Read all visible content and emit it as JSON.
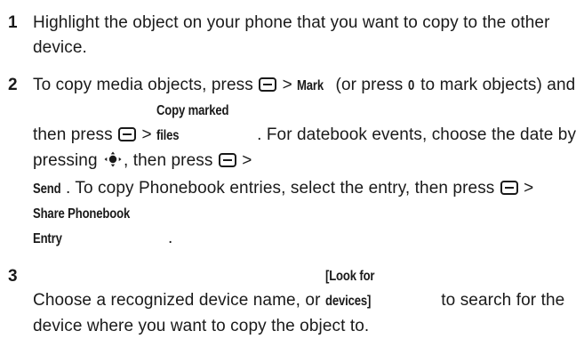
{
  "steps": [
    {
      "number": "1",
      "segments": {
        "s1": "Highlight the object on your phone that you want to copy to the other device."
      }
    },
    {
      "number": "2",
      "segments": {
        "s1": "To copy media objects, press ",
        "s2": " > ",
        "s3": "Mark",
        "s4": " (or press ",
        "s5": "0",
        "s6": " to mark objects) and then press ",
        "s7": " > ",
        "s8": "Copy marked files",
        "s9": ". For datebook events, choose the date by pressing ",
        "s10": ", then press ",
        "s11": " >",
        "s12": "Send",
        "s13": ". To copy Phonebook entries, select the entry, then press ",
        "s14": " > ",
        "s15": "Share Phonebook Entry",
        "s16": "."
      }
    },
    {
      "number": "3",
      "segments": {
        "s1": "Choose  a recognized device name, or ",
        "s2": "[Look for devices]",
        "s3": " to search for the device where you want to copy the object to."
      }
    }
  ],
  "icons": {
    "menu_key": "menu-key-icon",
    "nav_key": "navigation-key-icon"
  }
}
